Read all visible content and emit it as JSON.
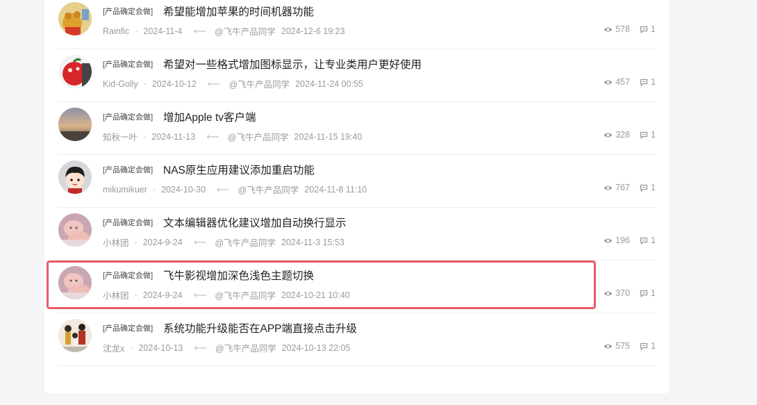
{
  "threads": [
    {
      "tag": "产品确定会做",
      "title": "希望能增加苹果的时间机器功能",
      "author": "Rainfic",
      "date": "2024-11-4",
      "replier": "@飞牛产品同学",
      "reply_time": "2024-12-6 19:23",
      "views": "578",
      "replies": "1",
      "avatar": "winnie-pooh-avatar"
    },
    {
      "tag": "产品确定会做",
      "title": "希望对一些格式增加图标显示，让专业类用户更好使用",
      "author": "Kid-Golly",
      "date": "2024-10-12",
      "replier": "@飞牛产品同学",
      "reply_time": "2024-11-24 00:55",
      "views": "457",
      "replies": "1",
      "avatar": "apple-avatar"
    },
    {
      "tag": "产品确定会做",
      "title": "增加Apple tv客户端",
      "author": "知秋一叶",
      "date": "2024-11-13",
      "replier": "@飞牛产品同学",
      "reply_time": "2024-11-15 19:40",
      "views": "328",
      "replies": "1",
      "avatar": "sunset-avatar"
    },
    {
      "tag": "产品确定会做",
      "title": "NAS原生应用建议添加重启功能",
      "author": "mikumikuer",
      "date": "2024-10-30",
      "replier": "@飞牛产品同学",
      "reply_time": "2024-11-8 11:10",
      "views": "767",
      "replies": "1",
      "avatar": "cartoon-boy-avatar"
    },
    {
      "tag": "产品确定会做",
      "title": "文本编辑器优化建议增加自动换行显示",
      "author": "小林团",
      "date": "2024-9-24",
      "replier": "@飞牛产品同学",
      "reply_time": "2024-11-3 15:53",
      "views": "196",
      "replies": "1",
      "avatar": "baby-avatar"
    },
    {
      "tag": "产品确定会做",
      "title": "飞牛影视增加深色浅色主题切换",
      "author": "小林团",
      "date": "2024-9-24",
      "replier": "@飞牛产品同学",
      "reply_time": "2024-10-21 10:40",
      "views": "370",
      "replies": "1",
      "avatar": "baby-avatar"
    },
    {
      "tag": "产品确定会做",
      "title": "系统功能升级能否在APP端直接点击升级",
      "author": "沈龙x",
      "date": "2024-10-13",
      "replier": "@飞牛产品同学",
      "reply_time": "2024-10-13 22:05",
      "views": "575",
      "replies": "1",
      "avatar": "family-photo-avatar"
    }
  ],
  "colors": {
    "highlight": "#e85a6a",
    "muted": "#9a9a9a",
    "title": "#222222"
  }
}
